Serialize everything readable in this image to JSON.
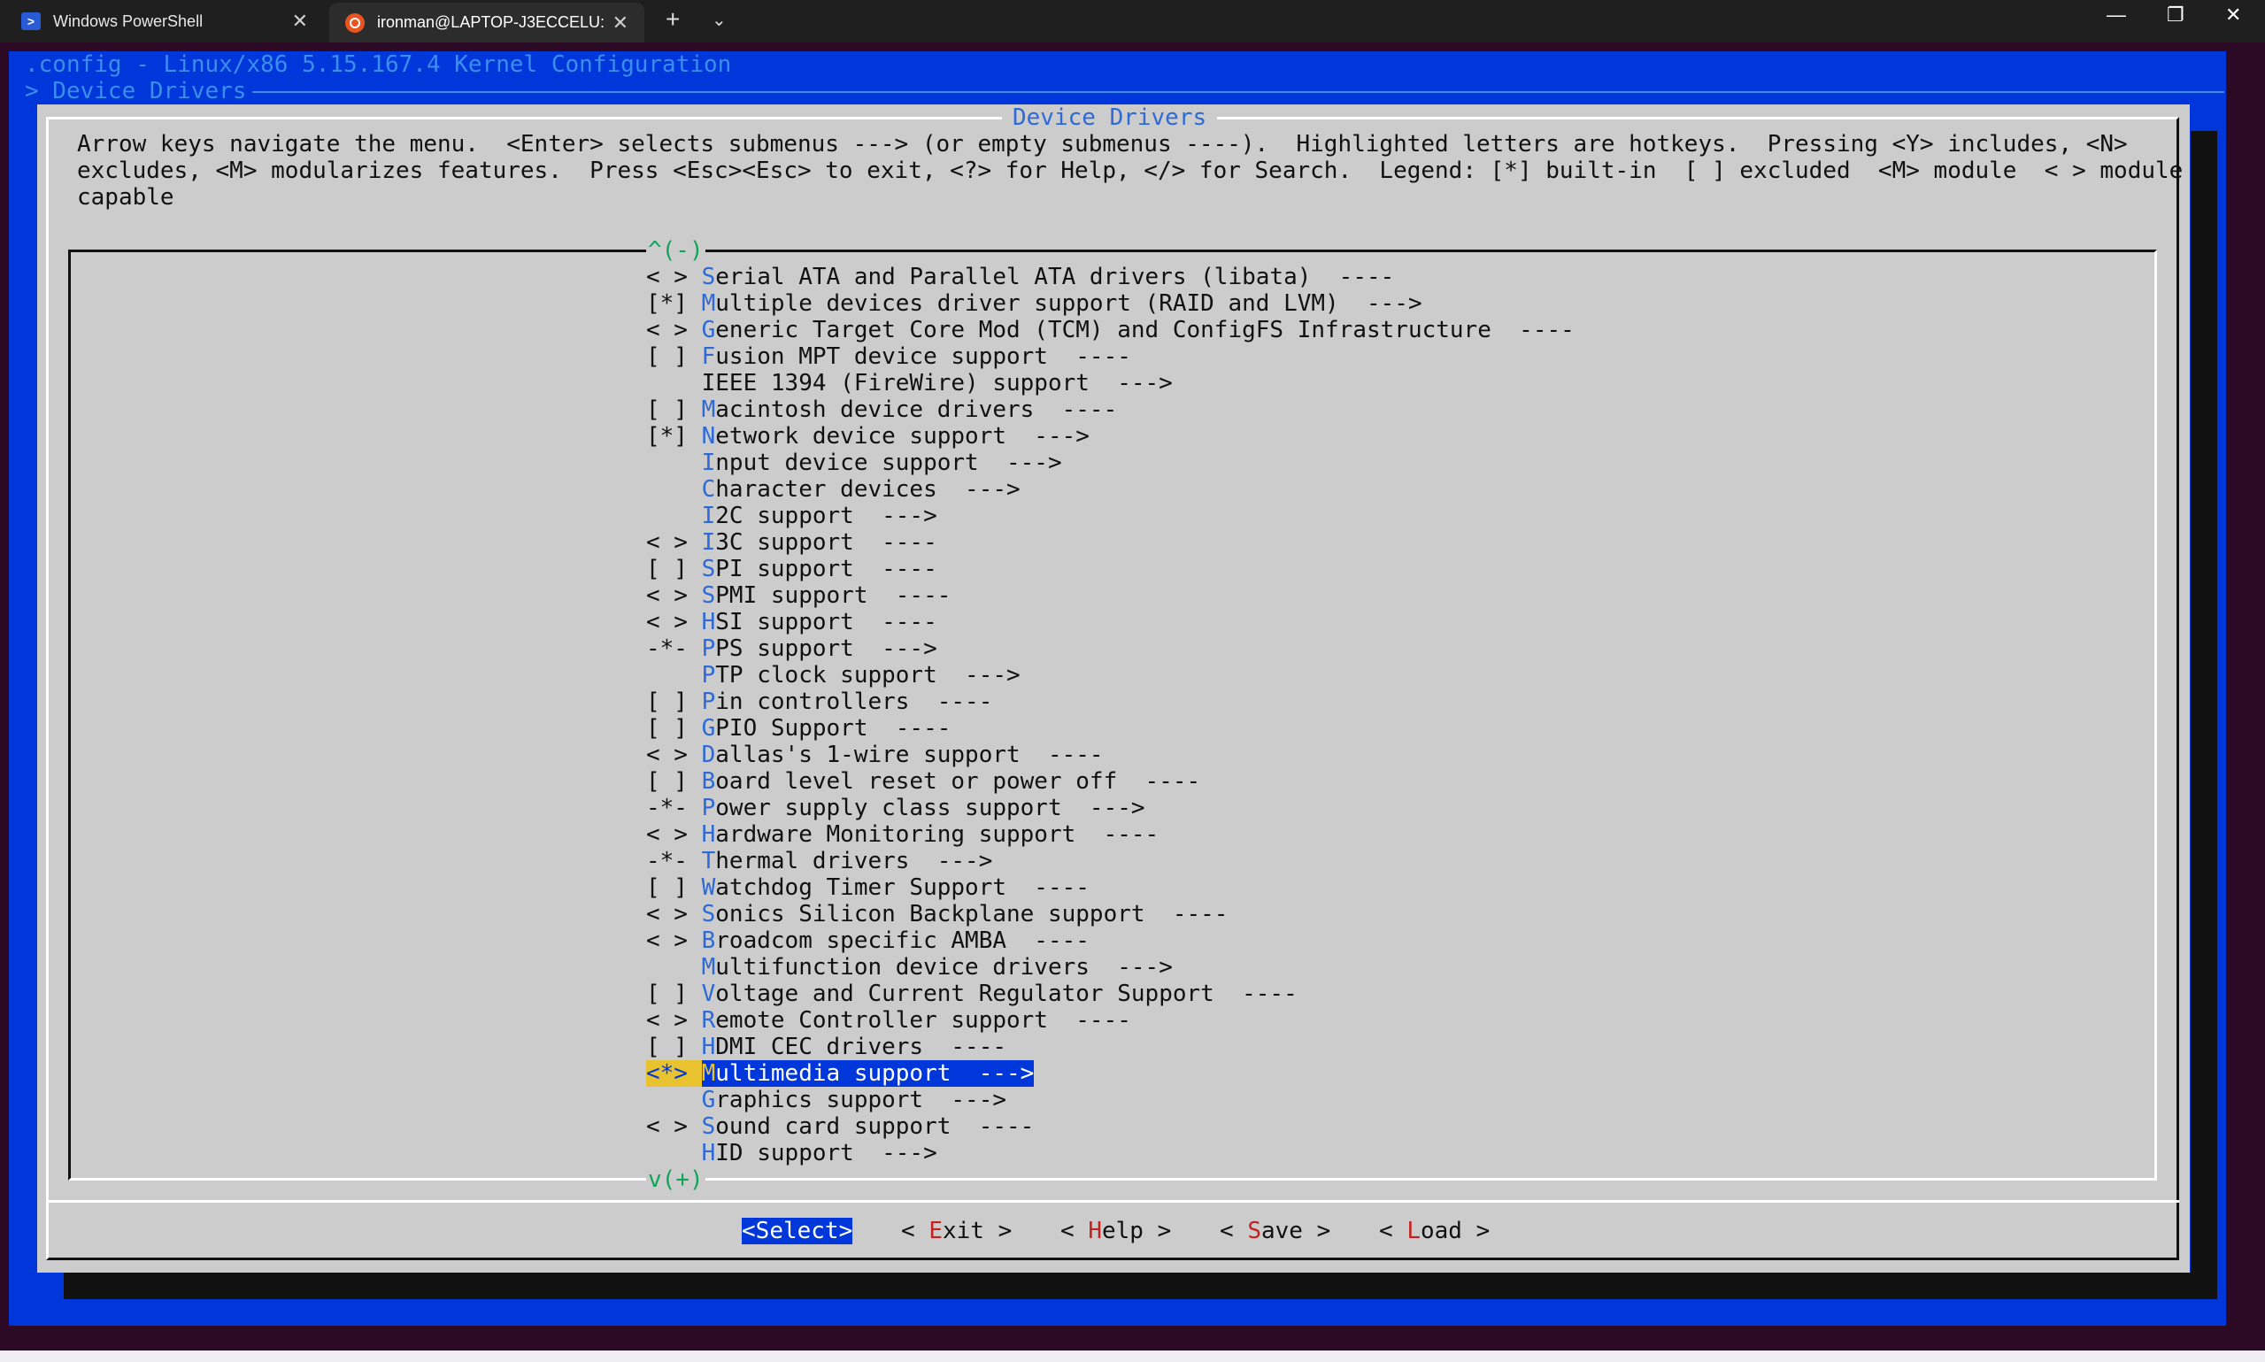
{
  "window": {
    "tabs": [
      {
        "label": "Windows PowerShell",
        "icon": "powershell-icon",
        "active": false
      },
      {
        "label": "ironman@LAPTOP-J3ECCELU:",
        "icon": "ubuntu-icon",
        "active": true
      }
    ],
    "new_tab": "+",
    "dropdown": "⌄",
    "minimize": "—",
    "maximize": "❐",
    "close": "✕"
  },
  "terminal": {
    "config_title": ".config - Linux/x86 5.15.167.4 Kernel Configuration",
    "breadcrumb": "> Device Drivers",
    "dialog_title": "Device Drivers",
    "help_lines": [
      "Arrow keys navigate the menu.  <Enter> selects submenus ---> (or empty submenus ----).  Highlighted letters are hotkeys.  Pressing <Y> includes, <N>",
      "excludes, <M> modularizes features.  Press <Esc><Esc> to exit, <?> for Help, </> for Search.  Legend: [*] built-in  [ ] excluded  <M> module  < > module",
      "capable"
    ],
    "scroll_up": "^(-)",
    "scroll_down": "v(+)",
    "menu_items": [
      {
        "state": "< > ",
        "hotkey": "S",
        "rest": "erial ATA and Parallel ATA drivers (libata)  ----"
      },
      {
        "state": "[*] ",
        "hotkey": "M",
        "rest": "ultiple devices driver support (RAID and LVM)  --->"
      },
      {
        "state": "< > ",
        "hotkey": "G",
        "rest": "eneric Target Core Mod (TCM) and ConfigFS Infrastructure  ----"
      },
      {
        "state": "[ ] ",
        "hotkey": "F",
        "rest": "usion MPT device support  ----"
      },
      {
        "state": "    ",
        "hotkey": "",
        "rest": "IEEE 1394 (FireWire) support  --->"
      },
      {
        "state": "[ ] ",
        "hotkey": "M",
        "rest": "acintosh device drivers  ----"
      },
      {
        "state": "[*] ",
        "hotkey": "N",
        "rest": "etwork device support  --->"
      },
      {
        "state": "    ",
        "hotkey": "I",
        "rest": "nput device support  --->"
      },
      {
        "state": "    ",
        "hotkey": "C",
        "rest": "haracter devices  --->"
      },
      {
        "state": "    ",
        "hotkey": "I",
        "rest": "2C support  --->"
      },
      {
        "state": "< > ",
        "hotkey": "I",
        "rest": "3C support  ----"
      },
      {
        "state": "[ ] ",
        "hotkey": "S",
        "rest": "PI support  ----"
      },
      {
        "state": "< > ",
        "hotkey": "S",
        "rest": "PMI support  ----"
      },
      {
        "state": "< > ",
        "hotkey": "H",
        "rest": "SI support  ----"
      },
      {
        "state": "-*- ",
        "hotkey": "P",
        "rest": "PS support  --->"
      },
      {
        "state": "    ",
        "hotkey": "P",
        "rest": "TP clock support  --->"
      },
      {
        "state": "[ ] ",
        "hotkey": "P",
        "rest": "in controllers  ----"
      },
      {
        "state": "[ ] ",
        "hotkey": "G",
        "rest": "PIO Support  ----"
      },
      {
        "state": "< > ",
        "hotkey": "D",
        "rest": "allas's 1-wire support  ----"
      },
      {
        "state": "[ ] ",
        "hotkey": "B",
        "rest": "oard level reset or power off  ----"
      },
      {
        "state": "-*- ",
        "hotkey": "P",
        "rest": "ower supply class support  --->"
      },
      {
        "state": "< > ",
        "hotkey": "H",
        "rest": "ardware Monitoring support  ----"
      },
      {
        "state": "-*- ",
        "hotkey": "T",
        "rest": "hermal drivers  --->"
      },
      {
        "state": "[ ] ",
        "hotkey": "W",
        "rest": "atchdog Timer Support  ----"
      },
      {
        "state": "< > ",
        "hotkey": "S",
        "rest": "onics Silicon Backplane support  ----"
      },
      {
        "state": "< > ",
        "hotkey": "B",
        "rest": "roadcom specific AMBA  ----"
      },
      {
        "state": "    ",
        "hotkey": "M",
        "rest": "ultifunction device drivers  --->"
      },
      {
        "state": "[ ] ",
        "hotkey": "V",
        "rest": "oltage and Current Regulator Support  ----"
      },
      {
        "state": "< > ",
        "hotkey": "R",
        "rest": "emote Controller support  ----"
      },
      {
        "state": "[ ] ",
        "hotkey": "H",
        "rest": "DMI CEC drivers  ----"
      },
      {
        "state": "<*> ",
        "hotkey": "M",
        "rest": "ultimedia support  --->",
        "active": true
      },
      {
        "state": "    ",
        "hotkey": "G",
        "rest": "raphics support  --->"
      },
      {
        "state": "< > ",
        "hotkey": "S",
        "rest": "ound card support  ----"
      },
      {
        "state": "    ",
        "hotkey": "H",
        "rest": "ID support  --->"
      }
    ],
    "buttons": {
      "select": {
        "pre": "<",
        "hotkey": "S",
        "post": "elect>"
      },
      "exit": {
        "pre": "< ",
        "hotkey": "E",
        "post": "xit >"
      },
      "help": {
        "pre": "< ",
        "hotkey": "H",
        "post": "elp >"
      },
      "save": {
        "pre": "< ",
        "hotkey": "S",
        "post": "ave >"
      },
      "load": {
        "pre": "< ",
        "hotkey": "L",
        "post": "oad >"
      }
    }
  },
  "colors": {
    "terminal_bg": "#2c0a26",
    "screen_blue": "#0037da",
    "dialog_gray": "#cccccc",
    "hotkey_blue": "#2d6ad8",
    "button_hotkey_red": "#c52020",
    "scroll_green": "#11a35a",
    "highlight_yellow": "#e8c32f"
  }
}
